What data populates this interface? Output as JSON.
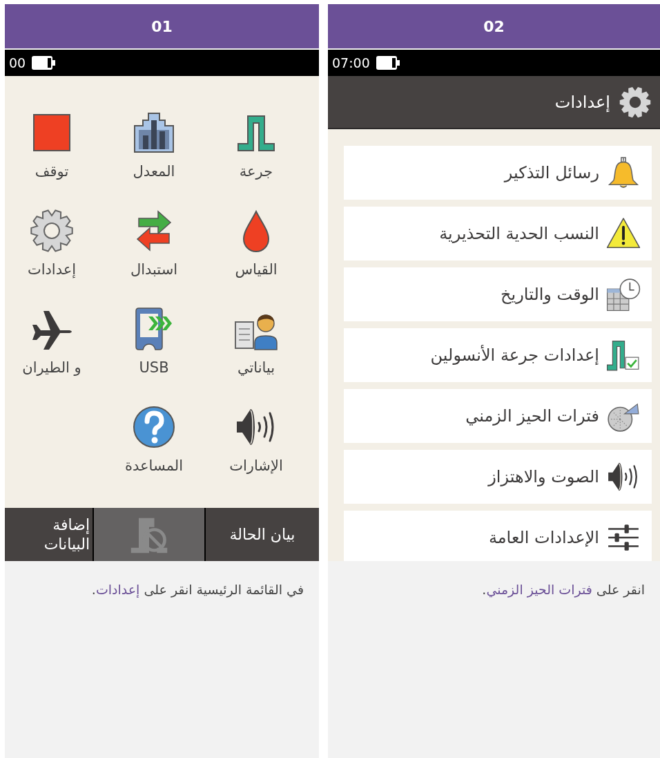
{
  "panels": [
    {
      "number": "02",
      "status_bar": {
        "time": "07:00"
      },
      "screen": {
        "kind": "list",
        "title": "إعدادات",
        "items": [
          {
            "label": "رسائل التذكير",
            "kind": "bell"
          },
          {
            "label": "النسب الحدية التحذيرية",
            "kind": "warning"
          },
          {
            "label": "الوقت والتاريخ",
            "kind": "calendar"
          },
          {
            "label": "إعدادات جرعة الأنسولين",
            "kind": "pulsecheck"
          },
          {
            "label": "فترات الحيز الزمني",
            "kind": "pie"
          },
          {
            "label": "الصوت والاهتزاز",
            "kind": "speaker"
          },
          {
            "label": "الإعدادات العامة",
            "kind": "sliders"
          }
        ]
      },
      "caption": {
        "before": "انقر على ",
        "link": "فترات الحيز الزمني",
        "after": "."
      }
    },
    {
      "number": "01",
      "status_bar": {
        "time": "00"
      },
      "screen": {
        "kind": "menu",
        "items": [
          {
            "label": "جرعة",
            "kind": "pulse"
          },
          {
            "label": "المعدل",
            "kind": "bars"
          },
          {
            "label": "توقف",
            "kind": "stop"
          },
          {
            "label": "القياس",
            "kind": "drop"
          },
          {
            "label": "استبدال",
            "kind": "swap"
          },
          {
            "label": "إعدادات",
            "kind": "gear"
          },
          {
            "label": "بياناتي",
            "kind": "person"
          },
          {
            "label": "USB",
            "kind": "device"
          },
          {
            "label": "و الطيران",
            "kind": "plane"
          },
          {
            "label": "الإشارات",
            "kind": "speaker"
          },
          {
            "label": "المساعدة",
            "kind": "help"
          }
        ],
        "softkeys": [
          {
            "label": "بيان الحالة",
            "disabled": false
          },
          {
            "kind": "nopulse",
            "disabled": true
          },
          {
            "label": "إضافة البيانات",
            "disabled": false
          }
        ]
      },
      "caption": {
        "before": "في القائمة الرئيسية انقر على ",
        "link": "إعدادات",
        "after": "."
      }
    }
  ]
}
